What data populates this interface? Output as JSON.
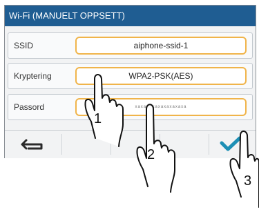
{
  "header": {
    "title": "Wi-Fi (MANUELT OPPSETT)"
  },
  "rows": [
    {
      "label": "SSID",
      "value": "aiphone-ssid-1"
    },
    {
      "label": "Kryptering",
      "value": "WPA2-PSK(AES)"
    },
    {
      "label": "Passord",
      "value": "xaxaxaxaxaxaxaxaxa"
    }
  ],
  "toolbar": {
    "back_icon": "back-arrow-icon",
    "confirm_icon": "checkmark-icon"
  },
  "colors": {
    "title_bg": "#1f5d92",
    "field_border": "#f0b44a",
    "confirm": "#1d8fb5"
  },
  "callouts": [
    "1",
    "2",
    "3"
  ]
}
